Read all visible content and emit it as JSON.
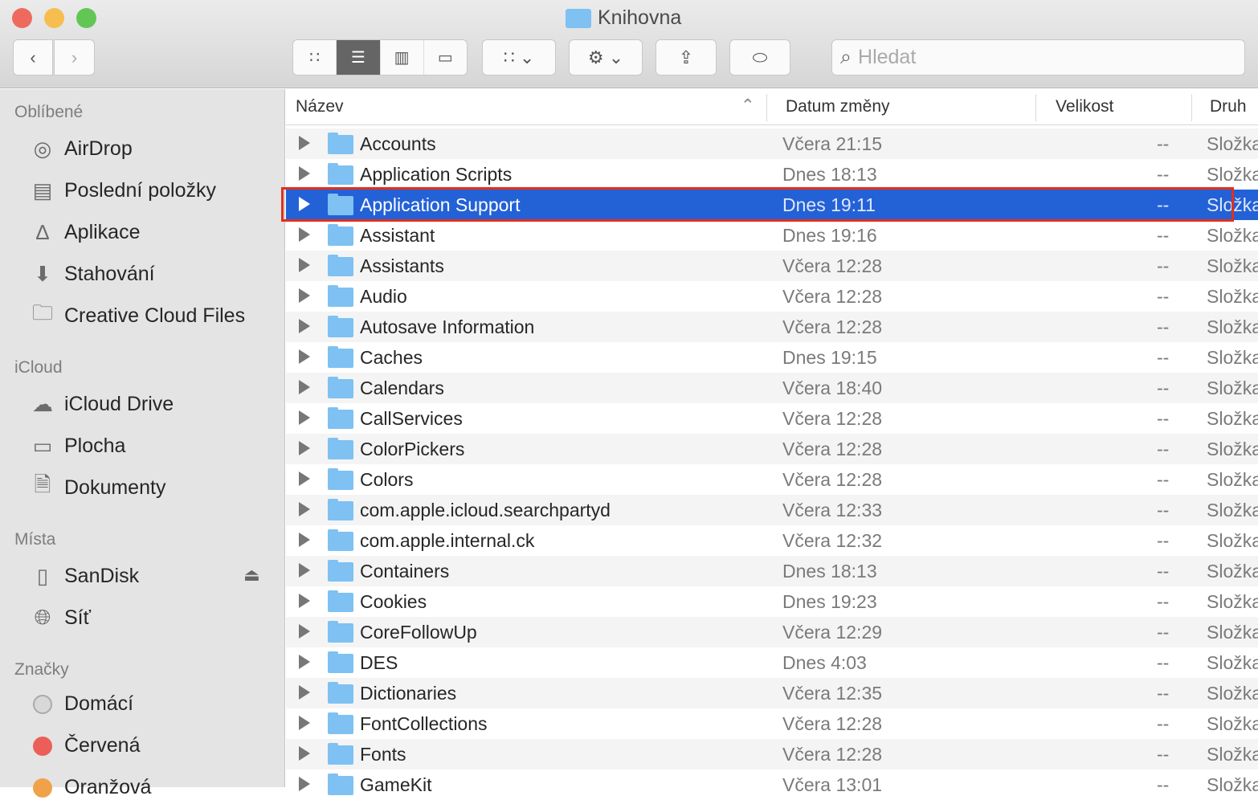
{
  "window": {
    "title": "Knihovna"
  },
  "toolbar": {
    "search_placeholder": "Hledat",
    "view_modes": [
      "icons",
      "list",
      "columns",
      "gallery"
    ],
    "active_view": "list"
  },
  "sidebar": {
    "sections": [
      {
        "title": "Oblíbené",
        "items": [
          {
            "label": "AirDrop",
            "icon": "airdrop-icon"
          },
          {
            "label": "Poslední položky",
            "icon": "recents-icon"
          },
          {
            "label": "Aplikace",
            "icon": "applications-icon"
          },
          {
            "label": "Stahování",
            "icon": "downloads-icon"
          },
          {
            "label": "Creative Cloud Files",
            "icon": "folder-icon"
          }
        ]
      },
      {
        "title": "iCloud",
        "items": [
          {
            "label": "iCloud Drive",
            "icon": "cloud-icon"
          },
          {
            "label": "Plocha",
            "icon": "desktop-icon"
          },
          {
            "label": "Dokumenty",
            "icon": "document-icon"
          }
        ]
      },
      {
        "title": "Místa",
        "items": [
          {
            "label": "SanDisk",
            "icon": "drive-icon"
          },
          {
            "label": "Síť",
            "icon": "network-icon"
          }
        ]
      },
      {
        "title": "Značky",
        "items": [
          {
            "label": "Domácí",
            "color": "#d8d8d8"
          },
          {
            "label": "Červená",
            "color": "#ec5f58"
          },
          {
            "label": "Oranžová",
            "color": "#f0a24a"
          }
        ]
      }
    ]
  },
  "columns": {
    "name": "Název",
    "date": "Datum změny",
    "size": "Velikost",
    "kind": "Druh"
  },
  "rows": [
    {
      "name": "Accounts",
      "date": "Včera 21:15",
      "size": "--",
      "kind": "Složka"
    },
    {
      "name": "Application Scripts",
      "date": "Dnes 18:13",
      "size": "--",
      "kind": "Složka"
    },
    {
      "name": "Application Support",
      "date": "Dnes 19:11",
      "size": "--",
      "kind": "Složka",
      "selected": true
    },
    {
      "name": "Assistant",
      "date": "Dnes 19:16",
      "size": "--",
      "kind": "Složka"
    },
    {
      "name": "Assistants",
      "date": "Včera 12:28",
      "size": "--",
      "kind": "Složka"
    },
    {
      "name": "Audio",
      "date": "Včera 12:28",
      "size": "--",
      "kind": "Složka"
    },
    {
      "name": "Autosave Information",
      "date": "Včera 12:28",
      "size": "--",
      "kind": "Složka"
    },
    {
      "name": "Caches",
      "date": "Dnes 19:15",
      "size": "--",
      "kind": "Složka"
    },
    {
      "name": "Calendars",
      "date": "Včera 18:40",
      "size": "--",
      "kind": "Složka"
    },
    {
      "name": "CallServices",
      "date": "Včera 12:28",
      "size": "--",
      "kind": "Složka"
    },
    {
      "name": "ColorPickers",
      "date": "Včera 12:28",
      "size": "--",
      "kind": "Složka"
    },
    {
      "name": "Colors",
      "date": "Včera 12:28",
      "size": "--",
      "kind": "Složka"
    },
    {
      "name": "com.apple.icloud.searchpartyd",
      "date": "Včera 12:33",
      "size": "--",
      "kind": "Složka"
    },
    {
      "name": "com.apple.internal.ck",
      "date": "Včera 12:32",
      "size": "--",
      "kind": "Složka"
    },
    {
      "name": "Containers",
      "date": "Dnes 18:13",
      "size": "--",
      "kind": "Složka"
    },
    {
      "name": "Cookies",
      "date": "Dnes 19:23",
      "size": "--",
      "kind": "Složka"
    },
    {
      "name": "CoreFollowUp",
      "date": "Včera 12:29",
      "size": "--",
      "kind": "Složka"
    },
    {
      "name": "DES",
      "date": "Dnes 4:03",
      "size": "--",
      "kind": "Složka"
    },
    {
      "name": "Dictionaries",
      "date": "Včera 12:35",
      "size": "--",
      "kind": "Složka"
    },
    {
      "name": "FontCollections",
      "date": "Včera 12:28",
      "size": "--",
      "kind": "Složka"
    },
    {
      "name": "Fonts",
      "date": "Včera 12:28",
      "size": "--",
      "kind": "Složka"
    },
    {
      "name": "GameKit",
      "date": "Včera 13:01",
      "size": "--",
      "kind": "Složka"
    }
  ]
}
